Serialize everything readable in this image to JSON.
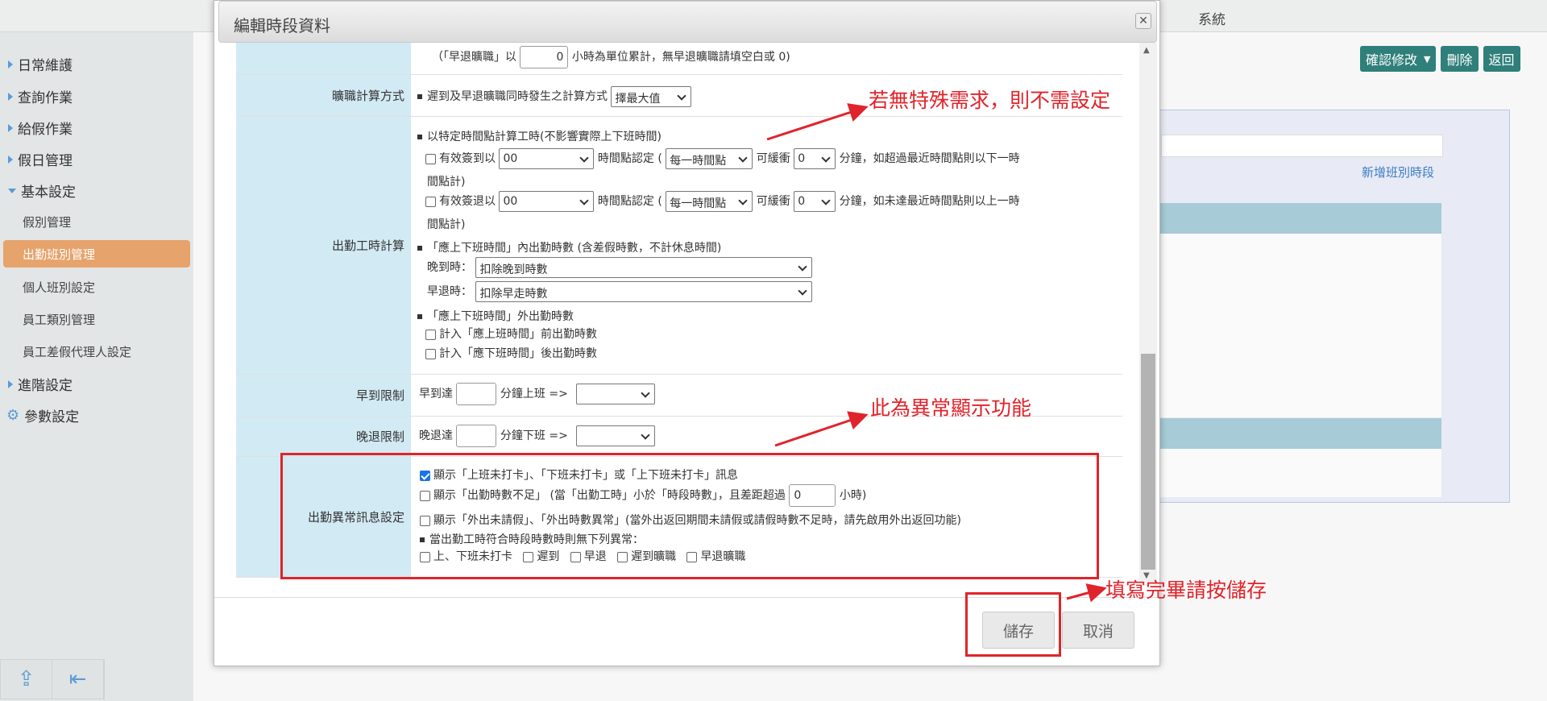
{
  "topbar": {
    "system_label": "系統"
  },
  "sidebar": {
    "items": [
      {
        "label": "日常維護"
      },
      {
        "label": "查詢作業"
      },
      {
        "label": "給假作業"
      },
      {
        "label": "假日管理"
      },
      {
        "label": "基本設定"
      }
    ],
    "sub_items": [
      {
        "label": "假別管理"
      },
      {
        "label": "出勤班別管理"
      },
      {
        "label": "個人班別設定"
      },
      {
        "label": "員工類別管理"
      },
      {
        "label": "員工差假代理人設定"
      }
    ],
    "items2": [
      {
        "label": "進階設定"
      },
      {
        "label": "參數設定"
      }
    ]
  },
  "toolbar": {
    "confirm_label": "確認修改",
    "delete_label": "刪除",
    "back_label": "返回"
  },
  "background": {
    "add_link": "新增班別時段"
  },
  "modal": {
    "title": "編輯時段資料",
    "rows": {
      "top_text_pre": "（「早退曠職」以",
      "top_value": "0",
      "top_text_post": "小時為單位累計，無早退曠職請填空白或 0)",
      "absent_calc_label": "曠職計算方式",
      "absent_calc_text": "遲到及早退曠職同時發生之計算方式",
      "absent_calc_select": "擇最大值",
      "work_hours_label": "出勤工時計算",
      "specific_time_text": "以特定時間點計算工時(不影響實際上下班時間)",
      "in_text": "有效簽到以",
      "in_select": "00",
      "time_point_text": "時間點認定 (",
      "every_hour_select": "每一時間點",
      "buffer_text": "可緩衝",
      "buffer_select": "0",
      "in_tail": "分鐘，如超過最近時間點則以下一時",
      "in_tail2": "間點計)",
      "out_text": "有效簽退以",
      "out_select": "00",
      "out_tail": "分鐘，如未達最近時間點則以上一時",
      "out_tail2": "間點計)",
      "within_text": "「應上下班時間」內出勤時數 (含差假時數，不計休息時間)",
      "late_label": "晚到時：",
      "late_select": "扣除晚到時數",
      "early_label": "早退時：",
      "early_select": "扣除早走時數",
      "outside_text": "「應上下班時間」外出勤時數",
      "before_text": "計入「應上班時間」前出勤時數",
      "after_text": "計入「應下班時間」後出勤時數",
      "early_arrival_label": "早到限制",
      "early_arrival_pre": "早到達",
      "early_arrival_post": "分鐘上班 =>",
      "late_leave_label": "晚退限制",
      "late_leave_pre": "晚退達",
      "late_leave_post": "分鐘下班 =>",
      "abnormal_label": "出勤異常訊息設定",
      "abn1": "顯示「上班未打卡」、「下班未打卡」或「上下班未打卡」訊息",
      "abn2_pre": "顯示「出勤時數不足」 (當「出勤工時」小於「時段時數」，且差距超過",
      "abn2_value": "0",
      "abn2_post": "小時)",
      "abn3": "顯示「外出未請假」、「外出時數異常」(當外出返回期間未請假或請假時數不足時，請先啟用外出返回功能)",
      "abn4": "當出勤工時符合時段時數時則無下列異常：",
      "abn_opts": [
        "上、下班未打卡",
        "遲到",
        "早退",
        "遲到曠職",
        "早退曠職"
      ]
    },
    "save_label": "儲存",
    "cancel_label": "取消"
  },
  "annotations": {
    "a1": "若無特殊需求，則不需設定",
    "a2": "此為異常顯示功能",
    "a3": "填寫完畢請按儲存"
  }
}
